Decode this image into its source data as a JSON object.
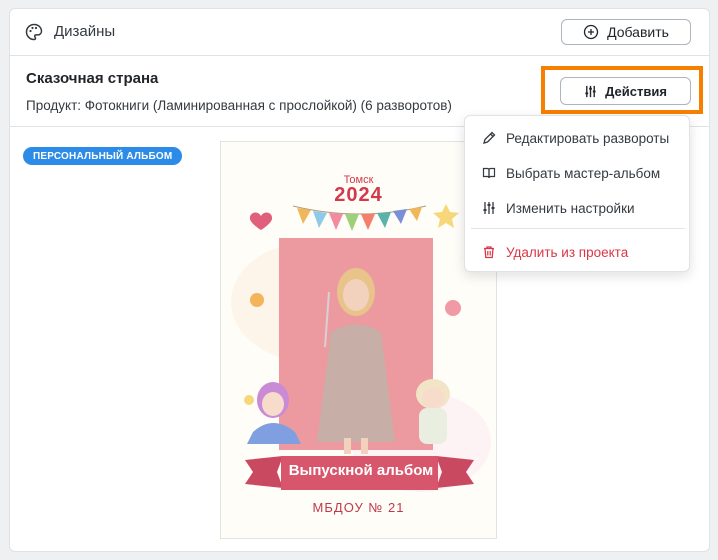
{
  "header": {
    "title": "Дизайны",
    "add_button": "Добавить"
  },
  "design": {
    "name": "Сказочная страна",
    "product": "Продукт: Фотокниги (Ламинированная с прослойкой) (6 разворотов)",
    "actions_button": "Действия",
    "badge": "ПЕРСОНАЛЬНЫЙ АЛЬБОМ"
  },
  "cover": {
    "city": "Томск",
    "year": "2024",
    "ribbon": "Выпускной альбом",
    "school": "МБДОУ № 21"
  },
  "menu": {
    "items": [
      {
        "label": "Редактировать развороты",
        "icon": "edit-icon"
      },
      {
        "label": "Выбрать мастер-альбом",
        "icon": "book-icon"
      },
      {
        "label": "Изменить настройки",
        "icon": "sliders-icon"
      },
      {
        "label": "Удалить из проекта",
        "icon": "trash-icon"
      }
    ]
  },
  "colors": {
    "badge": "#2b8be6",
    "highlight": "#f77f00",
    "danger": "#dc3545"
  }
}
